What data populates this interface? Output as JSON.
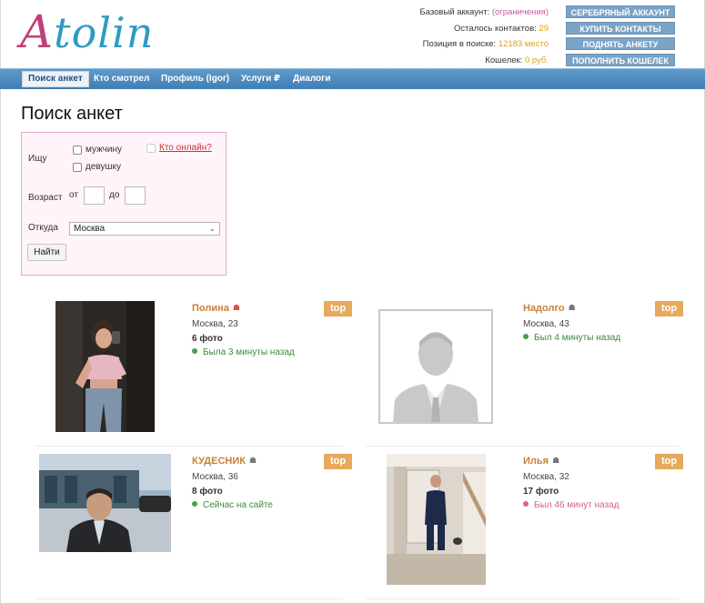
{
  "logo": {
    "first": "A",
    "rest": "tolin"
  },
  "account": {
    "base_label": "Базовый аккаунт: ",
    "base_value": "(ограничения)",
    "contacts_label": "Осталось контактов: ",
    "contacts_value": "29",
    "position_label": "Позиция в поиске: ",
    "position_value": "12183 место",
    "wallet_label": "Кошелек: ",
    "wallet_value": "0 руб.",
    "btn_silver": "СЕРЕБРЯНЫЙ АККАУНТ",
    "btn_buy": "КУПИТЬ КОНТАКТЫ",
    "btn_raise": "ПОДНЯТЬ АНКЕТУ",
    "btn_wallet": "ПОПОЛНИТЬ КОШЕЛЕК"
  },
  "nav": [
    "Поиск анкет",
    "Кто смотрел",
    "Профиль (Igor)",
    "Услуги ₽",
    "Диалоги"
  ],
  "page_title": "Поиск анкет",
  "search": {
    "seek_label": "Ищу",
    "opt_man": "мужчину",
    "opt_woman": "девушку",
    "online_link": "Кто онлайн?",
    "age_label": "Возраст",
    "from_label": "от",
    "to_label": "до",
    "from_label_short": "от",
    "city_label": "Откуда",
    "city_value": "Москва",
    "find_button": "Найти"
  },
  "profiles": [
    {
      "name": "Полина",
      "city_age": "Москва, 23",
      "photos": "6 фото",
      "status": "Была 3 минуты назад",
      "status_color": "#47a047",
      "badge": "top"
    },
    {
      "name": "Надолго",
      "city_age": "Москва, 43",
      "photos": "",
      "status": "Был 4 минуты назад",
      "status_color": "#47a047",
      "badge": "top"
    },
    {
      "name": "КУДЕСНИК",
      "city_age": "Москва, 36",
      "photos": "8 фото",
      "status": "Сейчас на сайте",
      "status_color": "#47a047",
      "badge": "top"
    },
    {
      "name": "Илья",
      "city_age": "Москва, 32",
      "photos": "17 фото",
      "status": "Был 46 минут назад",
      "status_color": "#e25c95",
      "badge": "top"
    }
  ]
}
